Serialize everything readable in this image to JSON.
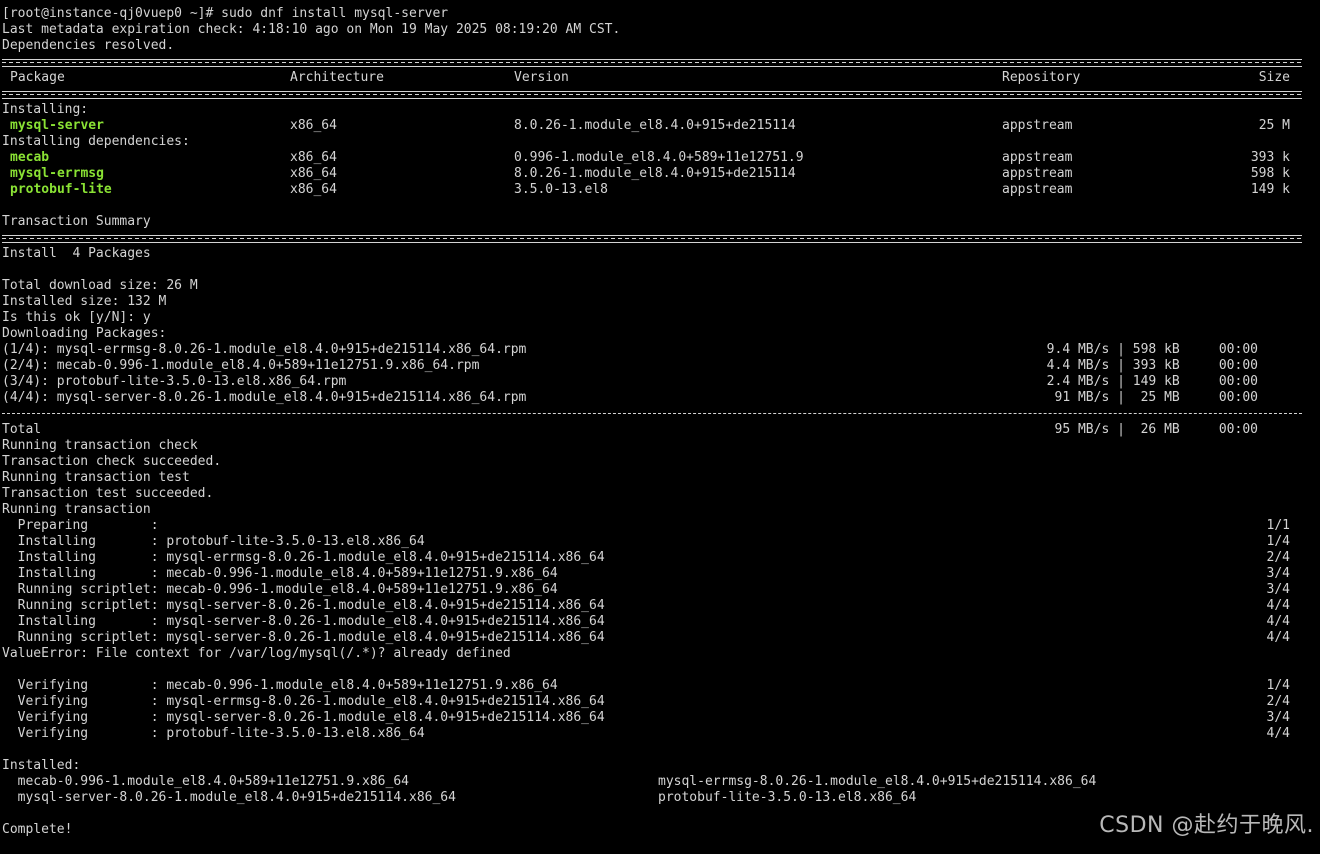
{
  "prompt_line": "[root@instance-qj0vuep0 ~]# sudo dnf install mysql-server",
  "meta_lines": [
    "Last metadata expiration check: 4:18:10 ago on Mon 19 May 2025 08:19:20 AM CST.",
    "Dependencies resolved."
  ],
  "table_header": {
    "package": "Package",
    "arch": "Architecture",
    "version": "Version",
    "repo": "Repository",
    "size": "Size"
  },
  "installing_label": "Installing:",
  "installing": [
    {
      "name": "mysql-server",
      "arch": "x86_64",
      "version": "8.0.26-1.module_el8.4.0+915+de215114",
      "repo": "appstream",
      "size": "25 M"
    }
  ],
  "deps_label": "Installing dependencies:",
  "dependencies": [
    {
      "name": "mecab",
      "arch": "x86_64",
      "version": "0.996-1.module_el8.4.0+589+11e12751.9",
      "repo": "appstream",
      "size": "393 k"
    },
    {
      "name": "mysql-errmsg",
      "arch": "x86_64",
      "version": "8.0.26-1.module_el8.4.0+915+de215114",
      "repo": "appstream",
      "size": "598 k"
    },
    {
      "name": "protobuf-lite",
      "arch": "x86_64",
      "version": "3.5.0-13.el8",
      "repo": "appstream",
      "size": "149 k"
    }
  ],
  "transaction_summary": "Transaction Summary",
  "install_line": "Install  4 Packages",
  "size_lines": [
    "Total download size: 26 M",
    "Installed size: 132 M",
    "Is this ok [y/N]: y",
    "Downloading Packages:"
  ],
  "downloads": [
    {
      "file": "(1/4): mysql-errmsg-8.0.26-1.module_el8.4.0+915+de215114.x86_64.rpm",
      "stats": "9.4 MB/s | 598 kB     00:00"
    },
    {
      "file": "(2/4): mecab-0.996-1.module_el8.4.0+589+11e12751.9.x86_64.rpm",
      "stats": "4.4 MB/s | 393 kB     00:00"
    },
    {
      "file": "(3/4): protobuf-lite-3.5.0-13.el8.x86_64.rpm",
      "stats": "2.4 MB/s | 149 kB     00:00"
    },
    {
      "file": "(4/4): mysql-server-8.0.26-1.module_el8.4.0+915+de215114.x86_64.rpm",
      "stats": " 91 MB/s |  25 MB     00:00"
    }
  ],
  "total": {
    "label": "Total",
    "stats": " 95 MB/s |  26 MB     00:00"
  },
  "txn_lines": [
    "Running transaction check",
    "Transaction check succeeded.",
    "Running transaction test",
    "Transaction test succeeded.",
    "Running transaction"
  ],
  "steps": [
    {
      "text": "  Preparing        :                                                        ",
      "count": "1/1"
    },
    {
      "text": "  Installing       : protobuf-lite-3.5.0-13.el8.x86_64",
      "count": "1/4"
    },
    {
      "text": "  Installing       : mysql-errmsg-8.0.26-1.module_el8.4.0+915+de215114.x86_64",
      "count": "2/4"
    },
    {
      "text": "  Installing       : mecab-0.996-1.module_el8.4.0+589+11e12751.9.x86_64",
      "count": "3/4"
    },
    {
      "text": "  Running scriptlet: mecab-0.996-1.module_el8.4.0+589+11e12751.9.x86_64",
      "count": "3/4"
    },
    {
      "text": "  Running scriptlet: mysql-server-8.0.26-1.module_el8.4.0+915+de215114.x86_64",
      "count": "4/4"
    },
    {
      "text": "  Installing       : mysql-server-8.0.26-1.module_el8.4.0+915+de215114.x86_64",
      "count": "4/4"
    },
    {
      "text": "  Running scriptlet: mysql-server-8.0.26-1.module_el8.4.0+915+de215114.x86_64",
      "count": "4/4"
    }
  ],
  "error_line": "ValueError: File context for /var/log/mysql(/.*)? already defined",
  "verify": [
    {
      "text": "  Verifying        : mecab-0.996-1.module_el8.4.0+589+11e12751.9.x86_64",
      "count": "1/4"
    },
    {
      "text": "  Verifying        : mysql-errmsg-8.0.26-1.module_el8.4.0+915+de215114.x86_64",
      "count": "2/4"
    },
    {
      "text": "  Verifying        : mysql-server-8.0.26-1.module_el8.4.0+915+de215114.x86_64",
      "count": "3/4"
    },
    {
      "text": "  Verifying        : protobuf-lite-3.5.0-13.el8.x86_64",
      "count": "4/4"
    }
  ],
  "installed_label": "Installed:",
  "installed": [
    {
      "left": "  mecab-0.996-1.module_el8.4.0+589+11e12751.9.x86_64",
      "right": "mysql-errmsg-8.0.26-1.module_el8.4.0+915+de215114.x86_64"
    },
    {
      "left": "  mysql-server-8.0.26-1.module_el8.4.0+915+de215114.x86_64",
      "right": "protobuf-lite-3.5.0-13.el8.x86_64"
    }
  ],
  "complete": "Complete!",
  "watermark": "CSDN @赴约于晚风.",
  "colors": {
    "background": "#000000",
    "text": "#d4d4d4",
    "package": "#8ae234"
  }
}
